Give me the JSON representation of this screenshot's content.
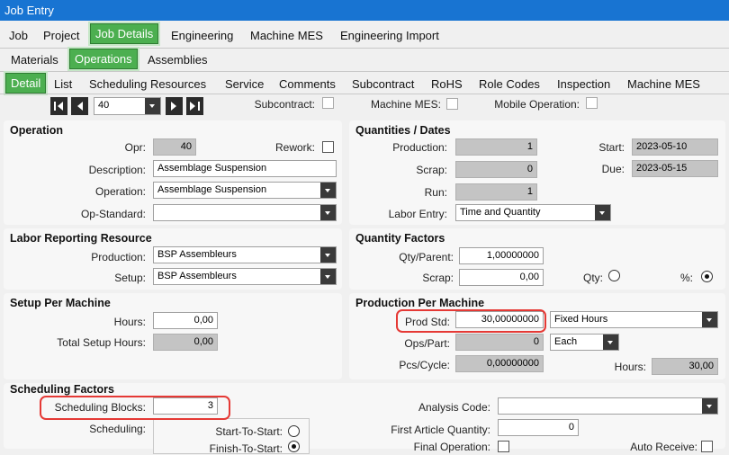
{
  "window": {
    "title": "Job Entry"
  },
  "tabs_row1": [
    "Job",
    "Project",
    "Job Details",
    "Engineering",
    "Machine MES",
    "Engineering Import"
  ],
  "tabs_row2": [
    "Materials",
    "Operations",
    "Assemblies"
  ],
  "tabs_row3": [
    "Detail",
    "List",
    "Scheduling Resources",
    "Service",
    "Comments",
    "Subcontract",
    "RoHS",
    "Role Codes",
    "Inspection",
    "Machine MES"
  ],
  "nav": {
    "record": "40"
  },
  "top_checks": {
    "subcontract": "Subcontract:",
    "machine_mes": "Machine MES:",
    "mobile_operation": "Mobile Operation:"
  },
  "operation": {
    "title": "Operation",
    "opr_label": "Opr:",
    "opr_value": "40",
    "rework_label": "Rework:",
    "description_label": "Description:",
    "description_value": "Assemblage Suspension",
    "operation_label": "Operation:",
    "operation_value": "Assemblage Suspension",
    "op_standard_label": "Op-Standard:",
    "op_standard_value": ""
  },
  "quantities": {
    "title": "Quantities / Dates",
    "production_label": "Production:",
    "production_value": "1",
    "scrap_label": "Scrap:",
    "scrap_value": "0",
    "run_label": "Run:",
    "run_value": "1",
    "labor_entry_label": "Labor Entry:",
    "labor_entry_value": "Time and Quantity",
    "start_label": "Start:",
    "start_value": "2023-05-10",
    "due_label": "Due:",
    "due_value": "2023-05-15"
  },
  "labor_resource": {
    "title": "Labor Reporting Resource",
    "production_label": "Production:",
    "production_value": "BSP Assembleurs",
    "setup_label": "Setup:",
    "setup_value": "BSP Assembleurs"
  },
  "quantity_factors": {
    "title": "Quantity Factors",
    "qty_parent_label": "Qty/Parent:",
    "qty_parent_value": "1,00000000",
    "scrap_label": "Scrap:",
    "scrap_value": "0,00",
    "qty_label": "Qty:",
    "pct_label": "%:"
  },
  "setup_per_machine": {
    "title": "Setup Per Machine",
    "hours_label": "Hours:",
    "hours_value": "0,00",
    "total_label": "Total Setup Hours:",
    "total_value": "0,00"
  },
  "production_per_machine": {
    "title": "Production Per Machine",
    "prod_std_label": "Prod Std:",
    "prod_std_value": "30,00000000",
    "prod_std_unit": "Fixed Hours",
    "ops_part_label": "Ops/Part:",
    "ops_part_value": "0",
    "ops_part_unit": "Each",
    "pcs_cycle_label": "Pcs/Cycle:",
    "pcs_cycle_value": "0,00000000",
    "hours_label": "Hours:",
    "hours_value": "30,00"
  },
  "scheduling": {
    "title": "Scheduling Factors",
    "blocks_label": "Scheduling Blocks:",
    "blocks_value": "3",
    "scheduling_label": "Scheduling:",
    "start_to_start": "Start-To-Start:",
    "finish_to_start": "Finish-To-Start:",
    "analysis_code_label": "Analysis Code:",
    "analysis_code_value": "",
    "first_article_label": "First Article Quantity:",
    "first_article_value": "0",
    "final_operation_label": "Final Operation:",
    "auto_receive_label": "Auto Receive:"
  }
}
